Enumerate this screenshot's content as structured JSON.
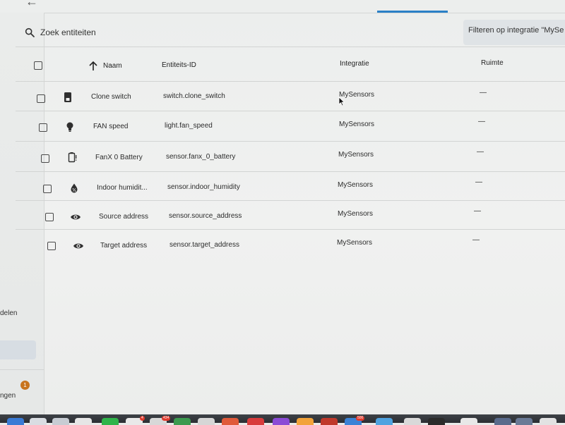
{
  "sidebar": {
    "item_delen_partial": "delen",
    "item_instellingen_partial": "ngen",
    "notification_count": "1"
  },
  "search": {
    "placeholder": "Zoek entiteiten"
  },
  "filter_chip": {
    "label": "Filteren op integratie \"MySe"
  },
  "table": {
    "headers": {
      "name": "Naam",
      "entity_id": "Entiteits-ID",
      "integration": "Integratie",
      "area": "Ruimte"
    },
    "rows": [
      {
        "icon": "switch-icon",
        "name": "Clone switch",
        "entity_id": "switch.clone_switch",
        "integration": "MySensors",
        "area": "—"
      },
      {
        "icon": "lightbulb-icon",
        "name": "FAN speed",
        "entity_id": "light.fan_speed",
        "integration": "MySensors",
        "area": "—"
      },
      {
        "icon": "battery-icon",
        "name": "FanX 0 Battery",
        "entity_id": "sensor.fanx_0_battery",
        "integration": "MySensors",
        "area": "—"
      },
      {
        "icon": "humidity-icon",
        "name": "Indoor humidit...",
        "entity_id": "sensor.indoor_humidity",
        "integration": "MySensors",
        "area": "—"
      },
      {
        "icon": "eye-icon",
        "name": "Source address",
        "entity_id": "sensor.source_address",
        "integration": "MySensors",
        "area": "—"
      },
      {
        "icon": "eye-icon",
        "name": "Target address",
        "entity_id": "sensor.target_address",
        "integration": "MySensors",
        "area": "—"
      }
    ]
  },
  "dock": {
    "badges": [
      "4",
      "434",
      "500"
    ]
  },
  "colors": {
    "accent": "#2a80c7",
    "badge": "#c8741e",
    "sidebar_selected": "#d7dde3"
  }
}
